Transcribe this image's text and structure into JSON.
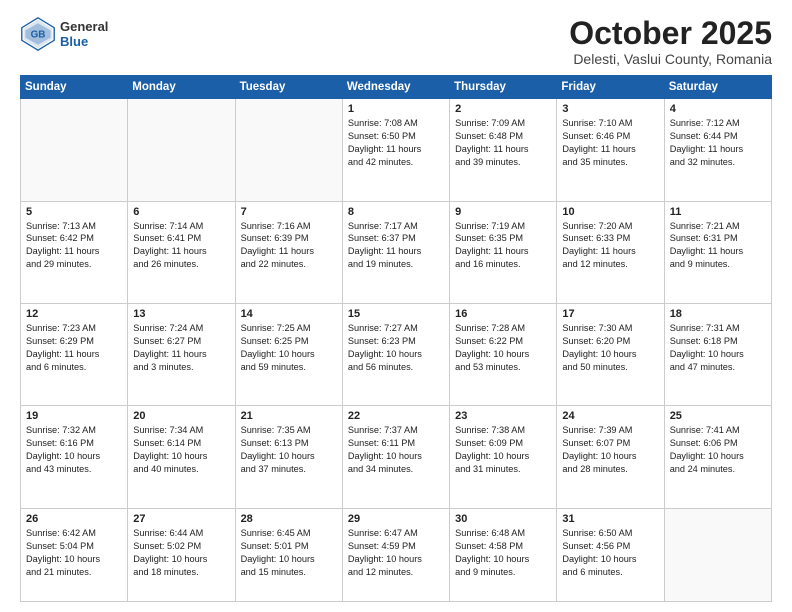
{
  "header": {
    "logo_general": "General",
    "logo_blue": "Blue",
    "month": "October 2025",
    "location": "Delesti, Vaslui County, Romania"
  },
  "weekdays": [
    "Sunday",
    "Monday",
    "Tuesday",
    "Wednesday",
    "Thursday",
    "Friday",
    "Saturday"
  ],
  "weeks": [
    [
      {
        "day": "",
        "text": ""
      },
      {
        "day": "",
        "text": ""
      },
      {
        "day": "",
        "text": ""
      },
      {
        "day": "1",
        "text": "Sunrise: 7:08 AM\nSunset: 6:50 PM\nDaylight: 11 hours\nand 42 minutes."
      },
      {
        "day": "2",
        "text": "Sunrise: 7:09 AM\nSunset: 6:48 PM\nDaylight: 11 hours\nand 39 minutes."
      },
      {
        "day": "3",
        "text": "Sunrise: 7:10 AM\nSunset: 6:46 PM\nDaylight: 11 hours\nand 35 minutes."
      },
      {
        "day": "4",
        "text": "Sunrise: 7:12 AM\nSunset: 6:44 PM\nDaylight: 11 hours\nand 32 minutes."
      }
    ],
    [
      {
        "day": "5",
        "text": "Sunrise: 7:13 AM\nSunset: 6:42 PM\nDaylight: 11 hours\nand 29 minutes."
      },
      {
        "day": "6",
        "text": "Sunrise: 7:14 AM\nSunset: 6:41 PM\nDaylight: 11 hours\nand 26 minutes."
      },
      {
        "day": "7",
        "text": "Sunrise: 7:16 AM\nSunset: 6:39 PM\nDaylight: 11 hours\nand 22 minutes."
      },
      {
        "day": "8",
        "text": "Sunrise: 7:17 AM\nSunset: 6:37 PM\nDaylight: 11 hours\nand 19 minutes."
      },
      {
        "day": "9",
        "text": "Sunrise: 7:19 AM\nSunset: 6:35 PM\nDaylight: 11 hours\nand 16 minutes."
      },
      {
        "day": "10",
        "text": "Sunrise: 7:20 AM\nSunset: 6:33 PM\nDaylight: 11 hours\nand 12 minutes."
      },
      {
        "day": "11",
        "text": "Sunrise: 7:21 AM\nSunset: 6:31 PM\nDaylight: 11 hours\nand 9 minutes."
      }
    ],
    [
      {
        "day": "12",
        "text": "Sunrise: 7:23 AM\nSunset: 6:29 PM\nDaylight: 11 hours\nand 6 minutes."
      },
      {
        "day": "13",
        "text": "Sunrise: 7:24 AM\nSunset: 6:27 PM\nDaylight: 11 hours\nand 3 minutes."
      },
      {
        "day": "14",
        "text": "Sunrise: 7:25 AM\nSunset: 6:25 PM\nDaylight: 10 hours\nand 59 minutes."
      },
      {
        "day": "15",
        "text": "Sunrise: 7:27 AM\nSunset: 6:23 PM\nDaylight: 10 hours\nand 56 minutes."
      },
      {
        "day": "16",
        "text": "Sunrise: 7:28 AM\nSunset: 6:22 PM\nDaylight: 10 hours\nand 53 minutes."
      },
      {
        "day": "17",
        "text": "Sunrise: 7:30 AM\nSunset: 6:20 PM\nDaylight: 10 hours\nand 50 minutes."
      },
      {
        "day": "18",
        "text": "Sunrise: 7:31 AM\nSunset: 6:18 PM\nDaylight: 10 hours\nand 47 minutes."
      }
    ],
    [
      {
        "day": "19",
        "text": "Sunrise: 7:32 AM\nSunset: 6:16 PM\nDaylight: 10 hours\nand 43 minutes."
      },
      {
        "day": "20",
        "text": "Sunrise: 7:34 AM\nSunset: 6:14 PM\nDaylight: 10 hours\nand 40 minutes."
      },
      {
        "day": "21",
        "text": "Sunrise: 7:35 AM\nSunset: 6:13 PM\nDaylight: 10 hours\nand 37 minutes."
      },
      {
        "day": "22",
        "text": "Sunrise: 7:37 AM\nSunset: 6:11 PM\nDaylight: 10 hours\nand 34 minutes."
      },
      {
        "day": "23",
        "text": "Sunrise: 7:38 AM\nSunset: 6:09 PM\nDaylight: 10 hours\nand 31 minutes."
      },
      {
        "day": "24",
        "text": "Sunrise: 7:39 AM\nSunset: 6:07 PM\nDaylight: 10 hours\nand 28 minutes."
      },
      {
        "day": "25",
        "text": "Sunrise: 7:41 AM\nSunset: 6:06 PM\nDaylight: 10 hours\nand 24 minutes."
      }
    ],
    [
      {
        "day": "26",
        "text": "Sunrise: 6:42 AM\nSunset: 5:04 PM\nDaylight: 10 hours\nand 21 minutes."
      },
      {
        "day": "27",
        "text": "Sunrise: 6:44 AM\nSunset: 5:02 PM\nDaylight: 10 hours\nand 18 minutes."
      },
      {
        "day": "28",
        "text": "Sunrise: 6:45 AM\nSunset: 5:01 PM\nDaylight: 10 hours\nand 15 minutes."
      },
      {
        "day": "29",
        "text": "Sunrise: 6:47 AM\nSunset: 4:59 PM\nDaylight: 10 hours\nand 12 minutes."
      },
      {
        "day": "30",
        "text": "Sunrise: 6:48 AM\nSunset: 4:58 PM\nDaylight: 10 hours\nand 9 minutes."
      },
      {
        "day": "31",
        "text": "Sunrise: 6:50 AM\nSunset: 4:56 PM\nDaylight: 10 hours\nand 6 minutes."
      },
      {
        "day": "",
        "text": ""
      }
    ]
  ]
}
